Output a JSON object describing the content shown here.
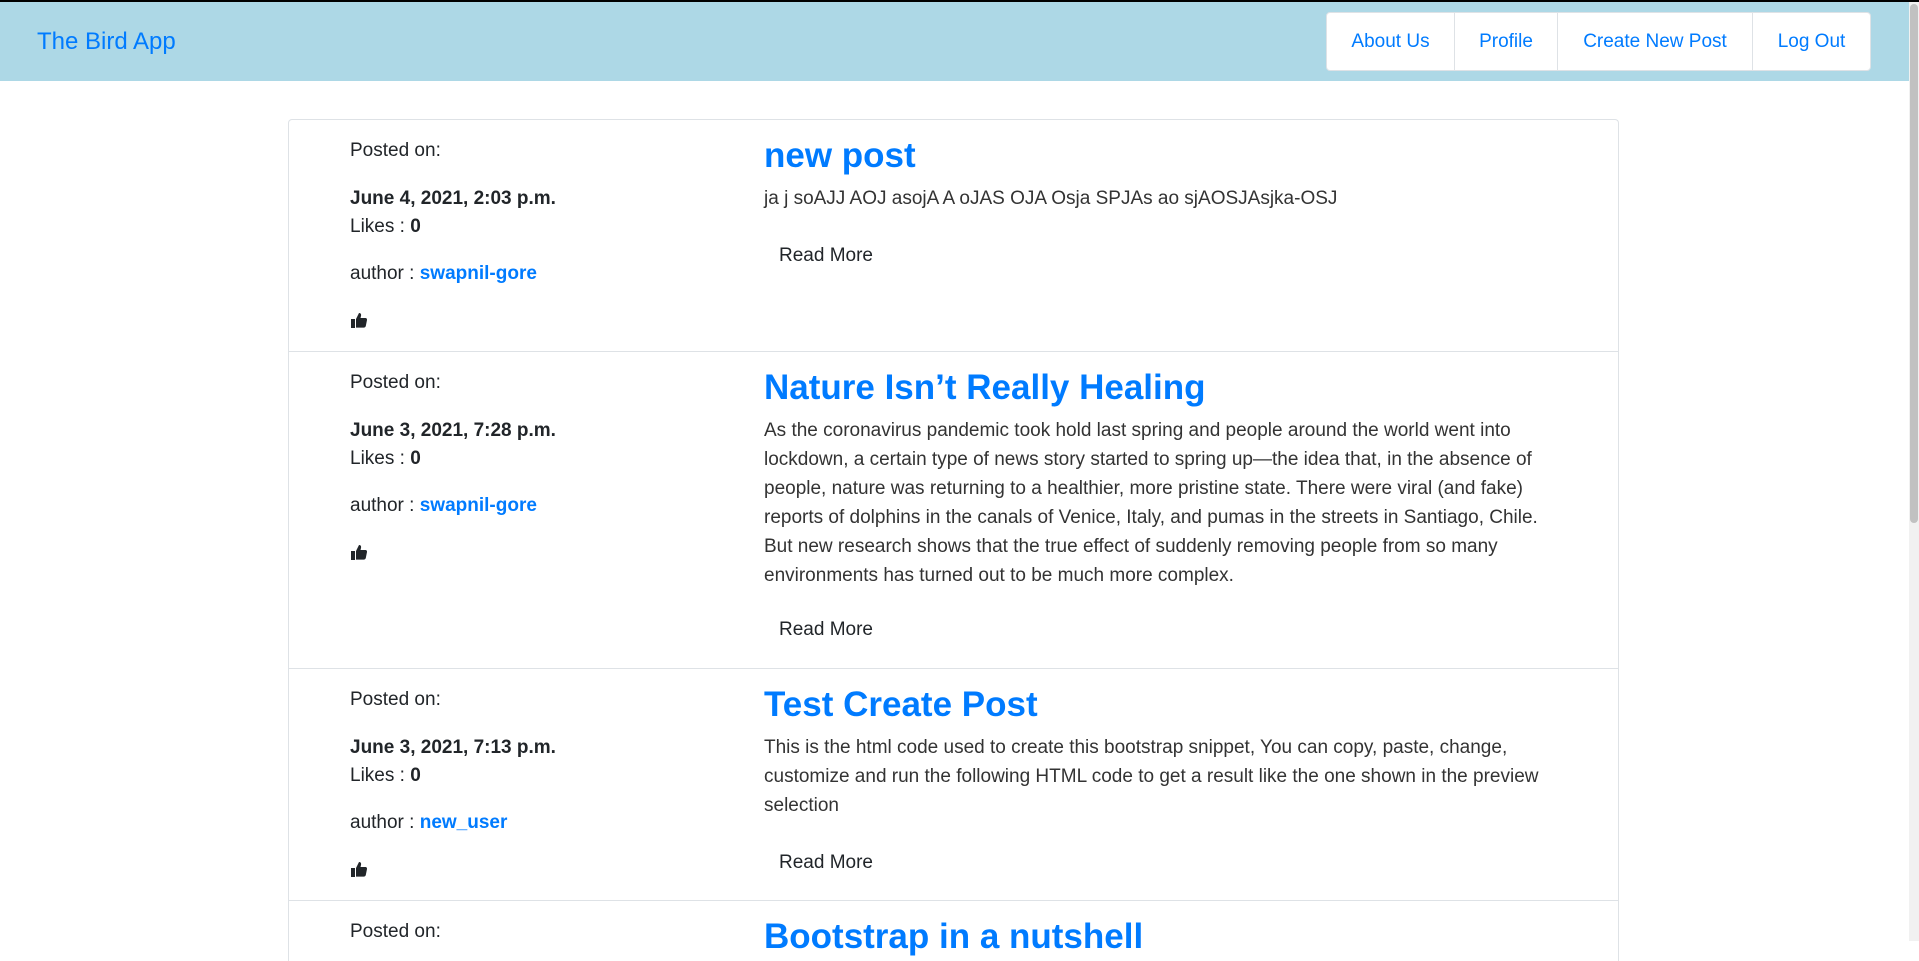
{
  "navbar": {
    "brand": "The Bird App",
    "links": [
      {
        "label": "About Us"
      },
      {
        "label": "Profile"
      },
      {
        "label": "Create New Post"
      },
      {
        "label": "Log Out"
      }
    ]
  },
  "post_labels": {
    "posted_on": "Posted on:",
    "likes": "Likes : ",
    "author": "author : ",
    "read_more": "Read More"
  },
  "posts": [
    {
      "date": "June 4, 2021, 2:03 p.m.",
      "likes": "0",
      "author": "swapnil-gore",
      "title": "new post",
      "body": "ja j soAJJ AOJ asojA A oJAS OJA Osja SPJAs ao sjAOSJAsjka-OSJ"
    },
    {
      "date": "June 3, 2021, 7:28 p.m.",
      "likes": "0",
      "author": "swapnil-gore",
      "title": "Nature Isn’t Really Healing",
      "body": "As the coronavirus pandemic took hold last spring and people around the world went into lockdown, a certain type of news story started to spring up—the idea that, in the absence of people, nature was returning to a healthier, more pristine state. There were viral (and fake) reports of dolphins in the canals of Venice, Italy, and pumas in the streets in Santiago, Chile. But new research shows that the true effect of suddenly removing people from so many environments has turned out to be much more complex."
    },
    {
      "date": "June 3, 2021, 7:13 p.m.",
      "likes": "0",
      "author": "new_user",
      "title": "Test Create Post",
      "body": "This is the html code used to create this bootstrap snippet, You can copy, paste, change, customize and run the following HTML code to get a result like the one shown in the preview selection"
    },
    {
      "title": "Bootstrap in a nutshell"
    }
  ],
  "icons": {
    "like": "thumbs-up-icon"
  },
  "colors": {
    "navbar_bg": "#add8e6",
    "link": "#007bff"
  }
}
